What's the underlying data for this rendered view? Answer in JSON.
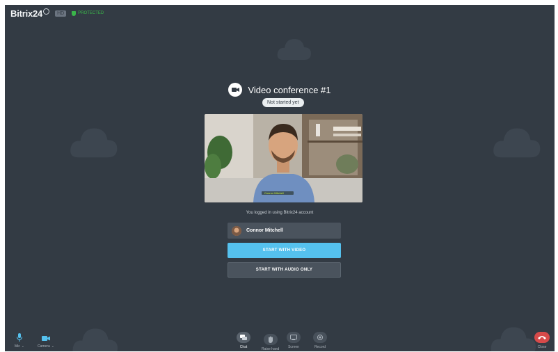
{
  "app": {
    "logo_text": "Bitrix24",
    "badge": "HD",
    "protected_label": "PROTECTED"
  },
  "conference": {
    "title": "Video conference #1",
    "status": "Not started yet"
  },
  "preview": {
    "name_tag": "Connor Mitchell"
  },
  "login": {
    "message": "You logged in using Bitrix24 account",
    "user_name": "Connor Mitchell"
  },
  "actions": {
    "start_video": "START WITH VIDEO",
    "start_audio": "START WITH AUDIO ONLY"
  },
  "bottom": {
    "mic_label": "Mic",
    "camera_label": "Camera",
    "chat_label": "Chat",
    "hand_label": "Raise hand",
    "screen_label": "Screen",
    "record_label": "Record",
    "close_label": "Close"
  },
  "colors": {
    "background": "#333b44",
    "accent": "#55c1ee",
    "danger": "#d64a4a",
    "protected": "#3ab54a"
  }
}
